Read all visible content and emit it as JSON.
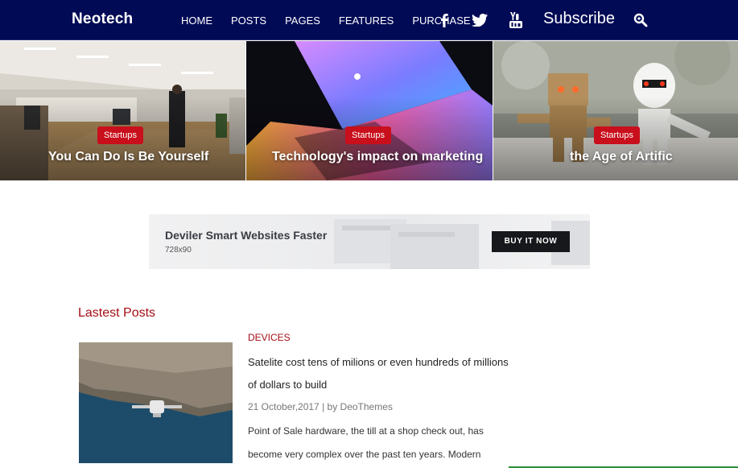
{
  "nav": {
    "brand": "Neotech",
    "links": [
      "HOME",
      "POSTS",
      "PAGES",
      "FEATURES",
      "PURCHASE"
    ],
    "social_icons": [
      "facebook-icon",
      "twitter-icon",
      "youtube-icon"
    ],
    "subscribe": "Subscribe",
    "search_icon": "search-icon"
  },
  "hero": {
    "tiles": [
      {
        "badge": "Startups",
        "title": "You Can Do Is Be Yourself"
      },
      {
        "badge": "Startups",
        "title": "Technology's impact on marketing"
      },
      {
        "badge": "Startups",
        "title": "the Age of Artific"
      }
    ]
  },
  "ad": {
    "title": "Deviler Smart Websites Faster",
    "size": "728x90",
    "button": "BUY IT NOW"
  },
  "latest": {
    "heading": "Lastest Posts",
    "post": {
      "category": "DEVICES",
      "title": "Satelite cost tens of milions or even hundreds of millions of dollars to build",
      "meta": "21 October,2017 | by DeoThemes",
      "excerpt": "Point of Sale hardware, the till at a shop check out, has become very complex over the past ten years. Modern"
    }
  },
  "colors": {
    "nav_bg": "#010a55",
    "accent_red": "#c80f1b",
    "heading_red": "#a50e16"
  }
}
